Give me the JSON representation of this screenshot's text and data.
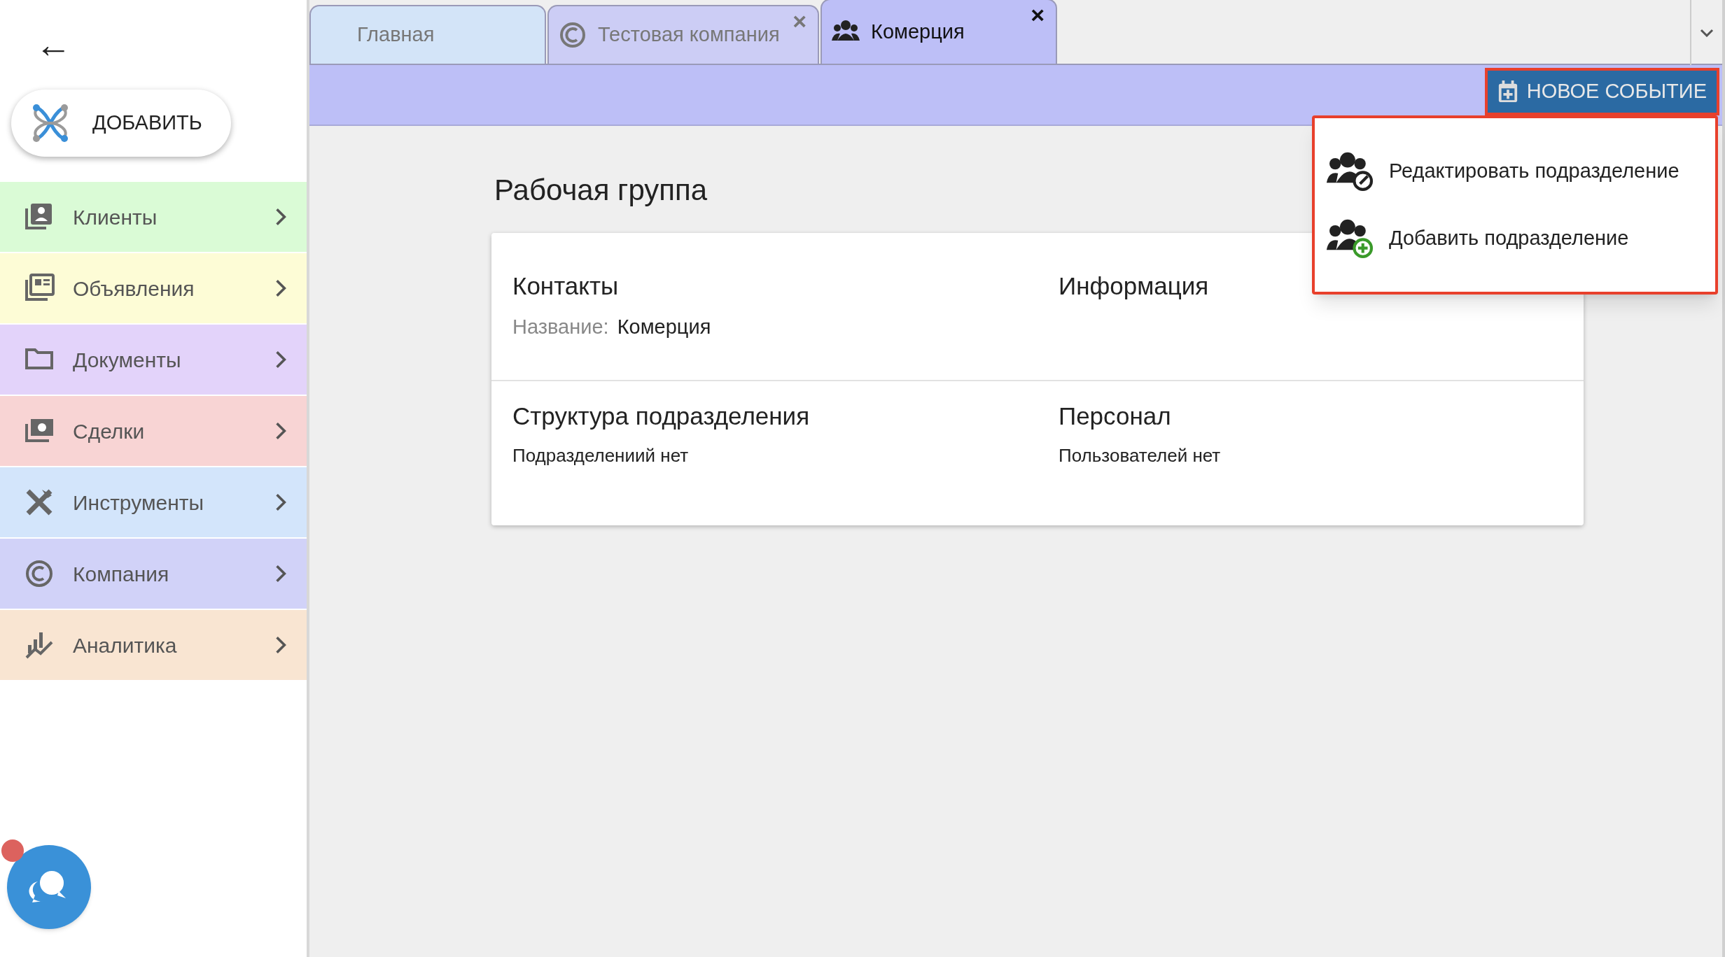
{
  "sidebar": {
    "back": "←",
    "add_button": "ДОБАВИТЬ",
    "items": [
      {
        "label": "Клиенты",
        "color": "#dafbd6"
      },
      {
        "label": "Объявления",
        "color": "#fdfcd6"
      },
      {
        "label": "Документы",
        "color": "#e3d3fa"
      },
      {
        "label": "Сделки",
        "color": "#f8d4d4"
      },
      {
        "label": "Инструменты",
        "color": "#d3e5fb"
      },
      {
        "label": "Компания",
        "color": "#d1d2f8"
      },
      {
        "label": "Аналитика",
        "color": "#f9e5d2"
      }
    ],
    "chat": {
      "unread": true
    }
  },
  "tabs": [
    {
      "label": "Главная",
      "kind": "plain",
      "selected": false,
      "color": "#d3e4f8"
    },
    {
      "label": "Тестовая компания",
      "kind": "company",
      "selected": false,
      "color": "#cccdf5",
      "close": "×"
    },
    {
      "label": "Комерция",
      "kind": "group",
      "selected": true,
      "color": "#bdbff7",
      "close": "×"
    }
  ],
  "toolbar": {
    "button": "НОВОЕ СОБЫТИЕ",
    "highlighted": true
  },
  "menu": {
    "highlighted": true,
    "items": [
      {
        "label": "Редактировать подразделение",
        "kind": "edit"
      },
      {
        "label": "Добавить подразделение",
        "kind": "add"
      }
    ]
  },
  "page_title": "Рабочая группа",
  "card": {
    "contacts": {
      "heading": "Контакты",
      "name_label": "Название:",
      "name_value": "Комерция"
    },
    "information": {
      "heading": "Информация"
    },
    "structure": {
      "heading": "Структура подразделения",
      "text": "Подразделениий нет"
    },
    "staff": {
      "heading": "Персонал",
      "text": "Пользователей нет"
    }
  }
}
